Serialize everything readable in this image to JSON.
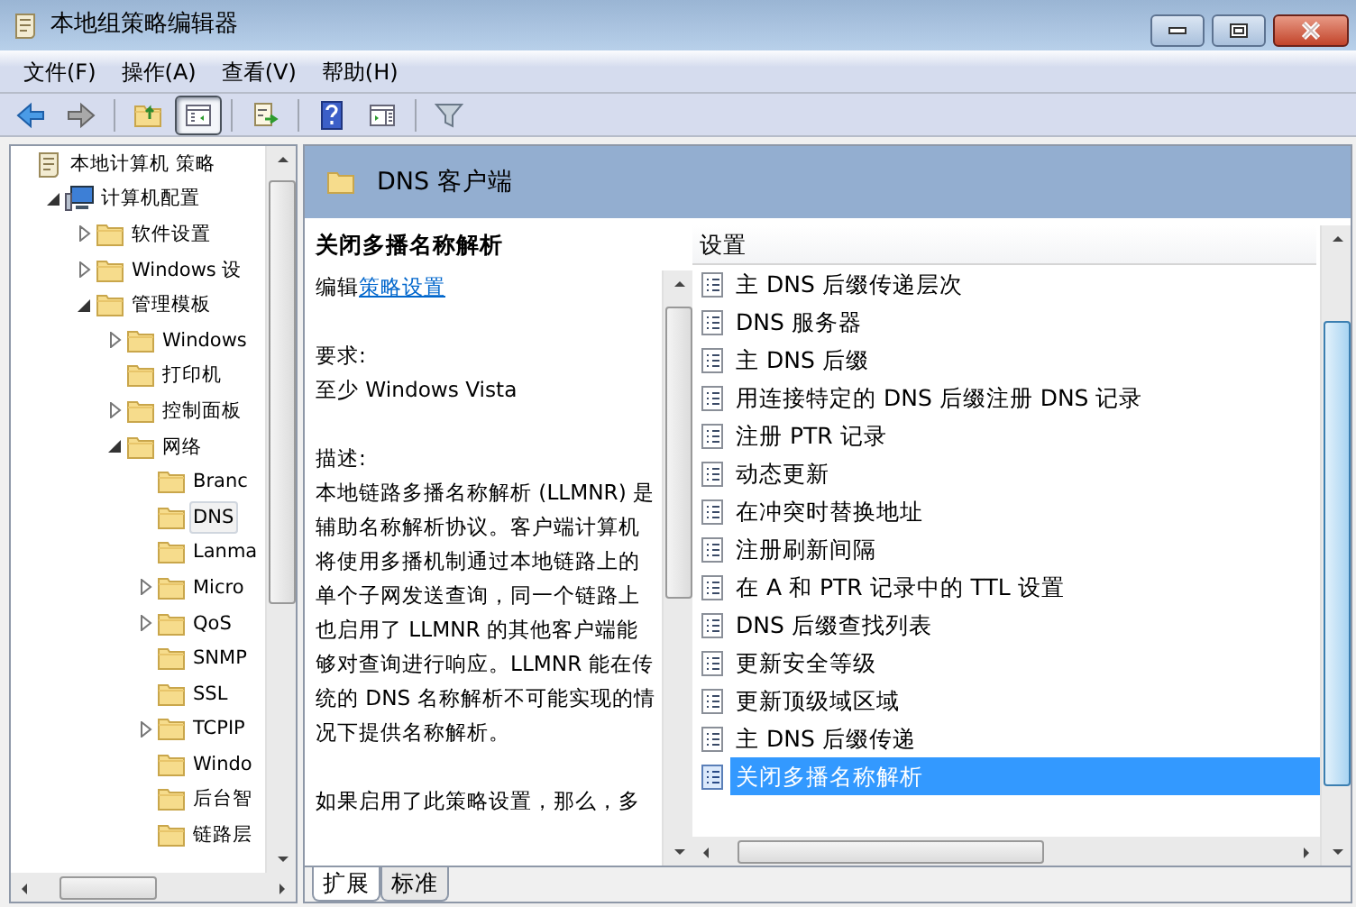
{
  "window": {
    "title": "本地组策略编辑器"
  },
  "menu": [
    "文件(F)",
    "操作(A)",
    "查看(V)",
    "帮助(H)"
  ],
  "toolbar": [
    {
      "kind": "back",
      "pressed": false
    },
    {
      "kind": "forward",
      "pressed": false
    },
    {
      "kind": "separator"
    },
    {
      "kind": "up",
      "pressed": false
    },
    {
      "kind": "tree",
      "pressed": true
    },
    {
      "kind": "separator"
    },
    {
      "kind": "export",
      "pressed": false
    },
    {
      "kind": "separator"
    },
    {
      "kind": "help",
      "pressed": false
    },
    {
      "kind": "pane",
      "pressed": false
    },
    {
      "kind": "separator"
    },
    {
      "kind": "filter",
      "pressed": false
    }
  ],
  "tree": [
    {
      "label": "本地计算机 策略",
      "kind": "policy",
      "selected": false,
      "children": [
        {
          "label": "计算机配置",
          "kind": "computer",
          "expanded": true,
          "selected": false,
          "children": [
            {
              "label": "软件设置",
              "kind": "folder",
              "expanded": false,
              "selected": false
            },
            {
              "label": "Windows 设",
              "kind": "folder",
              "expanded": false,
              "selected": false
            },
            {
              "label": "管理模板",
              "kind": "folder",
              "expanded": true,
              "selected": false,
              "children": [
                {
                  "label": "Windows",
                  "kind": "folder",
                  "expanded": false,
                  "selected": false
                },
                {
                  "label": "打印机",
                  "kind": "folder",
                  "selected": false
                },
                {
                  "label": "控制面板",
                  "kind": "folder",
                  "expanded": false,
                  "selected": false
                },
                {
                  "label": "网络",
                  "kind": "folder",
                  "expanded": true,
                  "selected": false,
                  "children": [
                    {
                      "label": "Branc",
                      "kind": "folder",
                      "selected": false
                    },
                    {
                      "label": "DNS",
                      "kind": "folder",
                      "selected": true
                    },
                    {
                      "label": "Lanma",
                      "kind": "folder",
                      "selected": false
                    },
                    {
                      "label": "Micro",
                      "kind": "folder",
                      "expanded": false,
                      "selected": false
                    },
                    {
                      "label": "QoS",
                      "kind": "folder",
                      "expanded": false,
                      "selected": false
                    },
                    {
                      "label": "SNMP",
                      "kind": "folder",
                      "selected": false
                    },
                    {
                      "label": "SSL",
                      "kind": "folder",
                      "selected": false
                    },
                    {
                      "label": "TCPIP",
                      "kind": "folder",
                      "expanded": false,
                      "selected": false
                    },
                    {
                      "label": "Windo",
                      "kind": "folder",
                      "selected": false
                    },
                    {
                      "label": "后台智",
                      "kind": "folder",
                      "selected": false
                    },
                    {
                      "label": "链路层",
                      "kind": "folder",
                      "selected": false
                    }
                  ]
                }
              ]
            }
          ]
        }
      ]
    }
  ],
  "details": {
    "header": "DNS 客户端",
    "title": "关闭多播名称解析",
    "edit_prefix": "编辑",
    "edit_link": "策略设置",
    "requirements_label": "要求:",
    "requirements": "至少 Windows Vista",
    "description_label": "描述:",
    "description": "本地链路多播名称解析 (LLMNR) 是辅助名称解析协议。客户端计算机将使用多播机制通过本地链路上的单个子网发送查询，同一个链路上也启用了 LLMNR 的其他客户端能够对查询进行响应。LLMNR 能在传统的 DNS 名称解析不可能实现的情况下提供名称解析。",
    "more": "如果启用了此策略设置，那么，多"
  },
  "settings": {
    "column": "设置",
    "items": [
      {
        "label": "主 DNS 后缀传递层次",
        "selected": false
      },
      {
        "label": "DNS 服务器",
        "selected": false
      },
      {
        "label": "主 DNS 后缀",
        "selected": false
      },
      {
        "label": "用连接特定的 DNS 后缀注册 DNS 记录",
        "selected": false
      },
      {
        "label": "注册 PTR 记录",
        "selected": false
      },
      {
        "label": "动态更新",
        "selected": false
      },
      {
        "label": "在冲突时替换地址",
        "selected": false
      },
      {
        "label": "注册刷新间隔",
        "selected": false
      },
      {
        "label": "在 A 和 PTR 记录中的 TTL 设置",
        "selected": false
      },
      {
        "label": "DNS 后缀查找列表",
        "selected": false
      },
      {
        "label": "更新安全等级",
        "selected": false
      },
      {
        "label": "更新顶级域区域",
        "selected": false
      },
      {
        "label": "主 DNS 后缀传递",
        "selected": false
      },
      {
        "label": "关闭多播名称解析",
        "selected": true
      }
    ]
  },
  "view_tabs": [
    {
      "label": "扩展",
      "selected": true
    },
    {
      "label": "标准",
      "selected": false
    }
  ]
}
